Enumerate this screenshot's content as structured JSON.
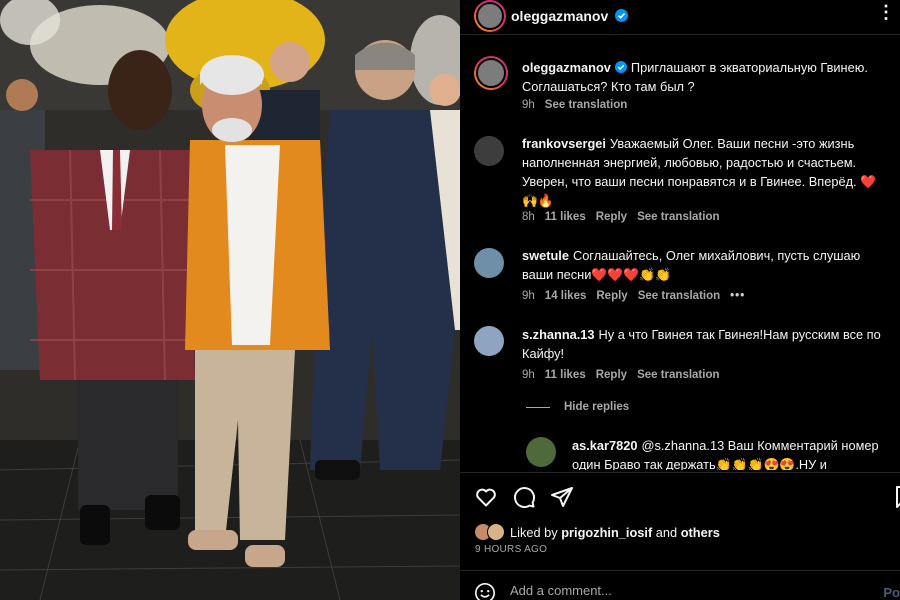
{
  "header": {
    "username": "oleggazmanov",
    "verified_icon": "verified-badge-icon",
    "more_icon": "more-options-icon"
  },
  "caption": {
    "username": "oleggazmanov",
    "text": "Приглашают в экваториальную Гвинею. Соглашаться? Кто там был ?",
    "time": "9h",
    "see_translation": "See translation"
  },
  "comments": [
    {
      "username": "frankovsergei",
      "text": "Уважаемый Олег. Ваши песни -это жизнь наполненная энергией, любовью, радостью и счастьем. Уверен, что ваши песни понравятся и в Гвинее. Вперёд. ❤️🙌🔥",
      "time": "8h",
      "likes": "11 likes",
      "reply": "Reply",
      "see_translation": "See translation"
    },
    {
      "username": "swetule",
      "text": "Соглашайтесь, Олег михайлович, пусть слушаю ваши песни❤️❤️❤️👏👏",
      "time": "9h",
      "likes": "14 likes",
      "reply": "Reply",
      "see_translation": "See translation",
      "more": "•••"
    },
    {
      "username": "s.zhanna.13",
      "text": "Ну а что Гвинея так Гвинея!Нам русским все по Кайфу!",
      "time": "9h",
      "likes": "11 likes",
      "reply": "Reply",
      "see_translation": "See translation"
    }
  ],
  "hide_replies": "Hide replies",
  "reply_comment": {
    "username": "as.kar7820",
    "text": "@s.zhanna.13 Ваш Комментарий номер один Браво так держать👏👏👏😍😍.НУ и"
  },
  "actions": {
    "like_icon": "heart-icon",
    "comment_icon": "comment-icon",
    "share_icon": "share-icon",
    "save_icon": "bookmark-icon"
  },
  "likes_line": {
    "prefix": "Liked by",
    "user": "prigozhin_iosif",
    "and": "and",
    "others": "others"
  },
  "post_time": "9 HOURS AGO",
  "add_comment": {
    "placeholder": "Add a comment...",
    "post_label": "Po",
    "emoji_icon": "emoji-icon"
  },
  "colors": {
    "background": "#000000",
    "text": "#f5f5f5",
    "muted": "#a8a8a8",
    "verified": "#0095f6",
    "orange_jacket": "#e38a1e",
    "plaid_blazer": "#7a2e33"
  }
}
